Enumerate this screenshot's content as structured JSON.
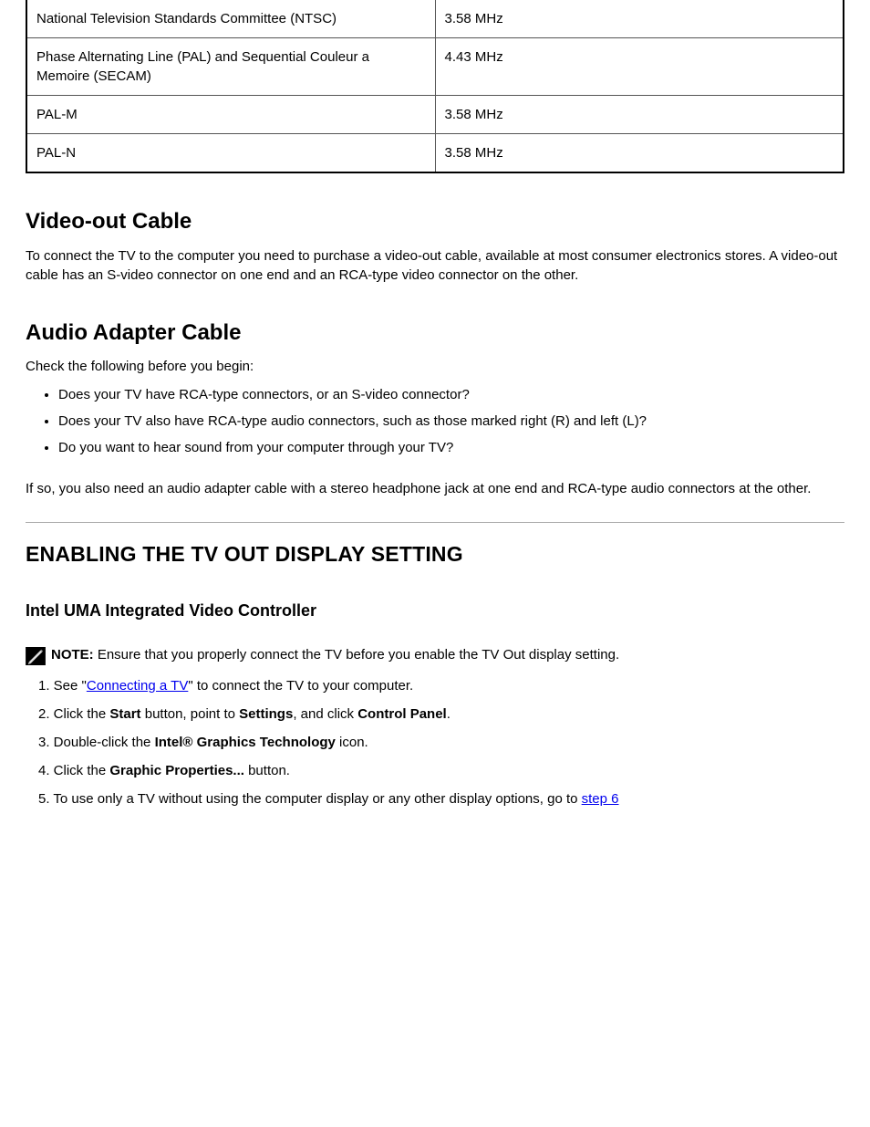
{
  "table": {
    "rows": [
      {
        "key": "National Television Standards Committee (NTSC)",
        "val": "3.58 MHz"
      },
      {
        "key": "Phase Alternating Line (PAL) and Sequential Couleur a Memoire (SECAM)",
        "val": "4.43 MHz"
      },
      {
        "key": "PAL-M",
        "val": "3.58 MHz"
      },
      {
        "key": "PAL-N",
        "val": "3.58 MHz"
      }
    ]
  },
  "title_video_out": "Video-out Cable",
  "video_out_body": "To connect the TV to the computer you need to purchase a video-out cable, available at most consumer electronics stores. A video-out cable has an S-video connector on one end and an RCA-type video connector on the other.",
  "title_audio": "Audio Adapter Cable",
  "audio_intro": "Check the following before you begin:",
  "audio_items": [
    "Does your TV have RCA-type connectors, or an S-video connector?",
    "Does your TV also have RCA-type audio connectors, such as those marked right (R) and left (L)?",
    "Do you want to hear sound from your computer through your TV?"
  ],
  "audio_outro": "If so, you also need an audio adapter cable with a stereo headphone jack at one end and RCA-type audio connectors at the other.",
  "section_caps": "ENABLING THE TV OUT DISPLAY SETTING",
  "intel_h3": "Intel UMA Integrated Video Controller",
  "note_label": "NOTE:",
  "note_body": " Ensure that you properly connect the TV before you enable the TV Out display setting.",
  "step1": {
    "prefix": "1. See \"",
    "link_text": "Connecting a TV",
    "suffix": "\" to connect the TV to your computer."
  },
  "step2_a": "2. Click the ",
  "step2_start": "Start",
  "step2_b": " button, point to ",
  "step2_settings": "Settings",
  "step2_c": ", and click ",
  "step2_cp": "Control Panel",
  "step2_d": ".",
  "step3_a": "3. Double-click the ",
  "step3_intel": "Intel® Graphics Technology",
  "step3_b": " icon.",
  "step4_a": "4. Click the ",
  "step4_btn": "Graphic Properties...",
  "step4_b": " button.",
  "step5_a": "5. To use only a TV without using the computer display or any other display options, go to ",
  "step5_link": "step 6"
}
